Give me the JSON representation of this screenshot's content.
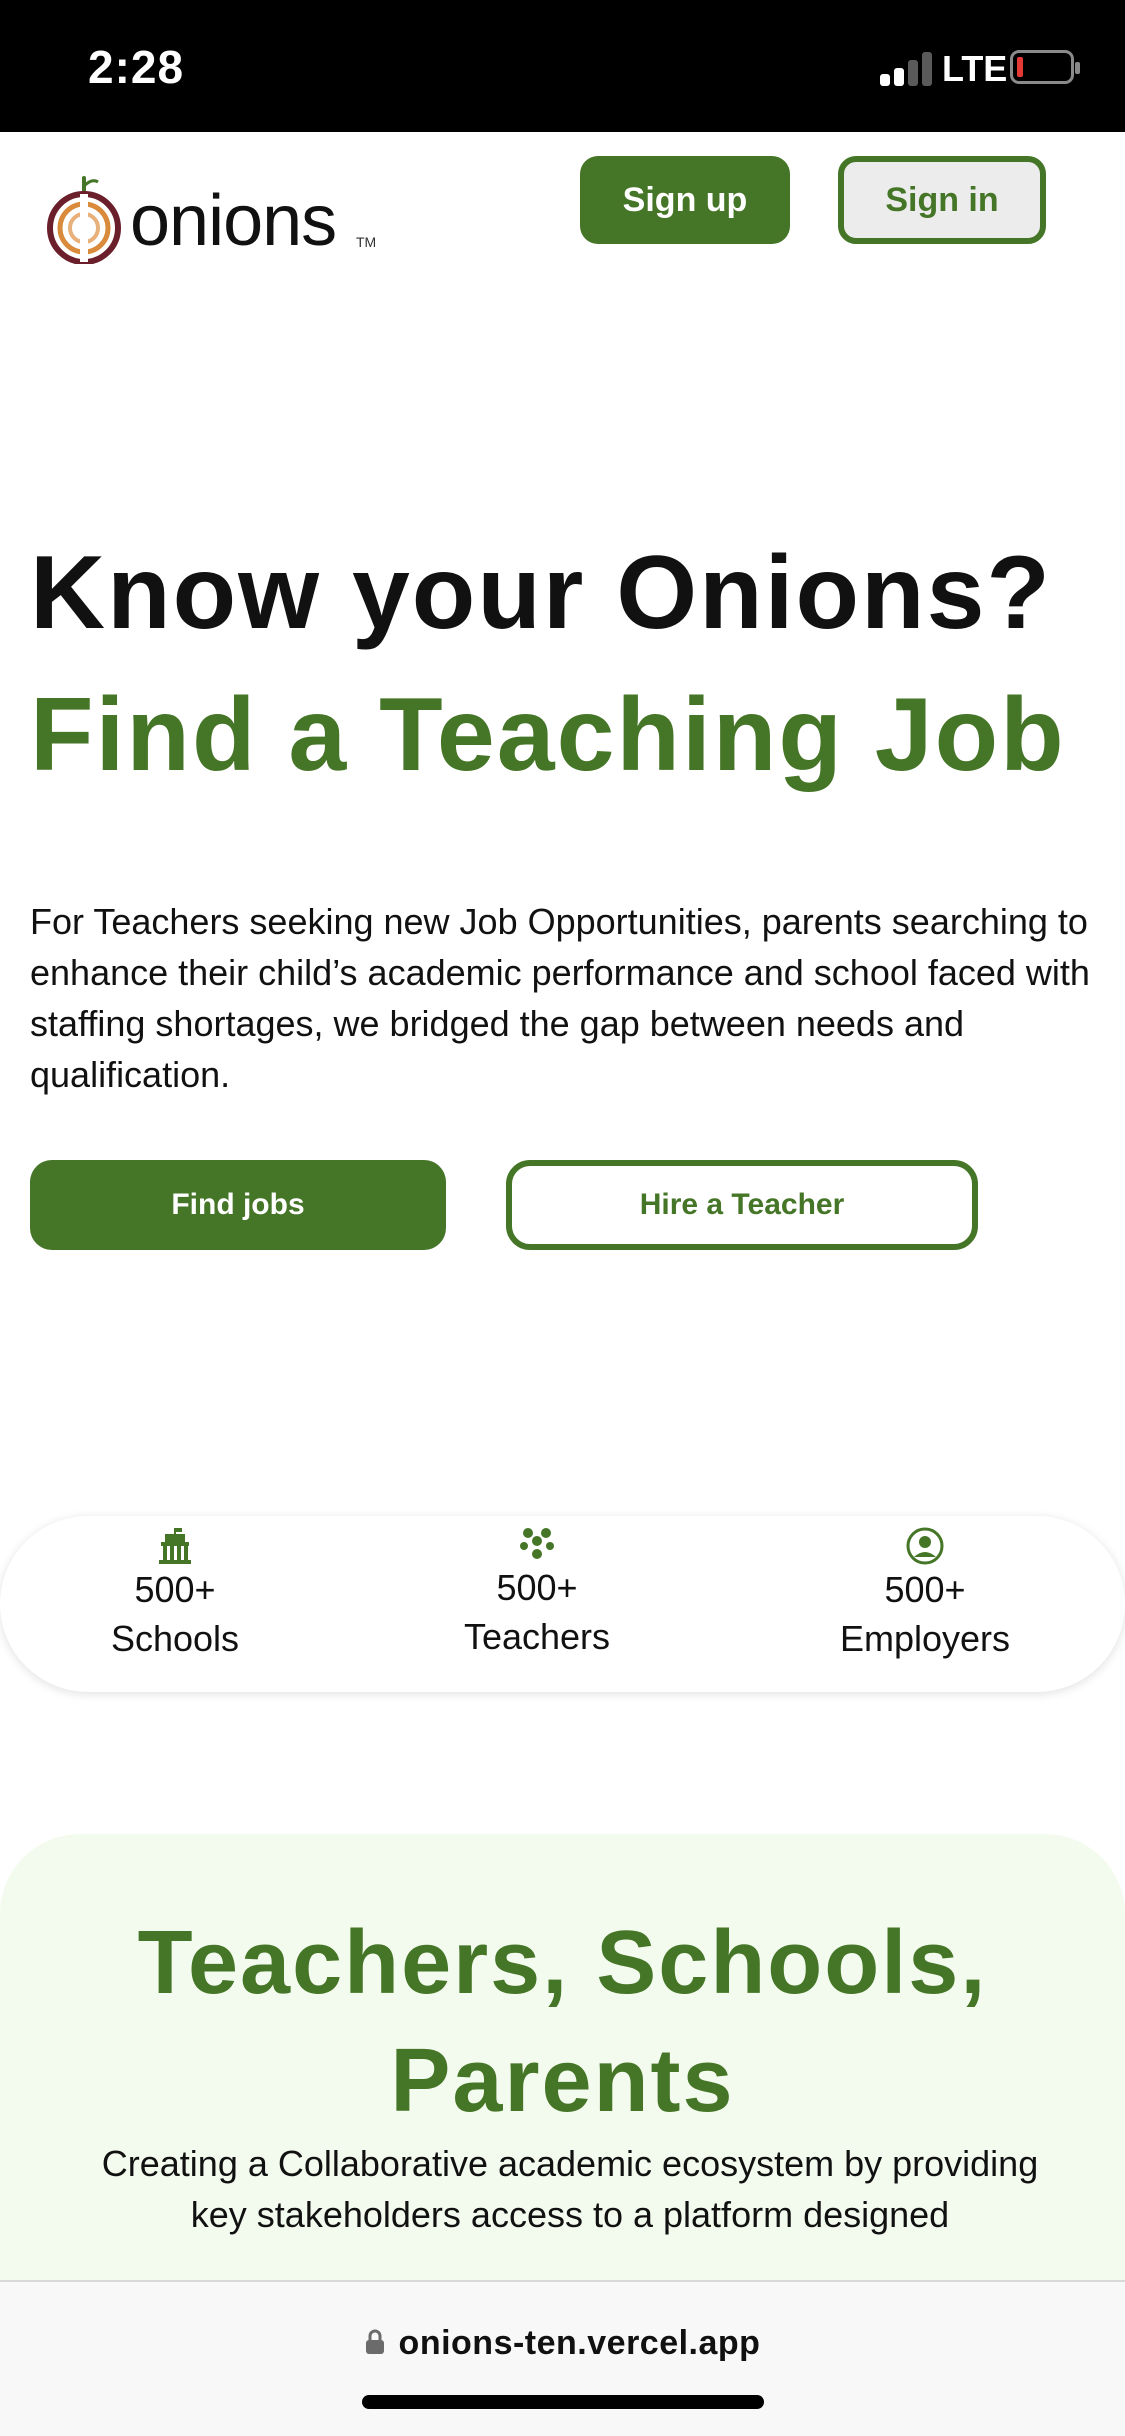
{
  "status_bar": {
    "time": "2:28",
    "network": "LTE"
  },
  "header": {
    "logo_text": "onions",
    "logo_tm": "TM",
    "signup_label": "Sign up",
    "signin_label": "Sign in"
  },
  "hero": {
    "title": "Know your Onions?",
    "subtitle": "Find a Teaching Job",
    "description": "For Teachers seeking new Job Opportunities, parents searching to enhance their child’s academic performance and school faced with staffing shortages, we bridged the gap between needs and qualification.",
    "find_jobs_label": "Find jobs",
    "hire_teacher_label": "Hire a Teacher"
  },
  "stats": [
    {
      "number": "500+",
      "label": "Schools",
      "icon": "school-icon"
    },
    {
      "number": "500+",
      "label": "Teachers",
      "icon": "group-icon"
    },
    {
      "number": "500+",
      "label": "Employers",
      "icon": "user-circle-icon"
    }
  ],
  "section": {
    "title": "Teachers, Schools, Parents",
    "description": "Creating a Collaborative academic ecosystem by providing key stakeholders access to a platform designed"
  },
  "browser": {
    "url": "onions-ten.vercel.app"
  },
  "colors": {
    "brand_green": "#457526",
    "section_bg": "#f3fbee"
  }
}
